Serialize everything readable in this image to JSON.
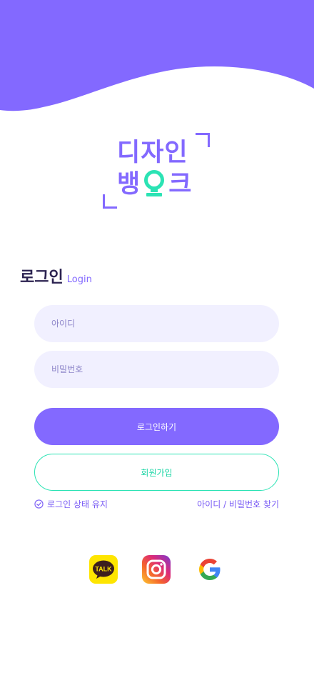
{
  "colors": {
    "accent": "#8369FF",
    "input_bg": "#F1F0FF",
    "join_border": "#2BE3B4",
    "join_text": "#1DD6A6",
    "title_text": "#2B2250"
  },
  "logo": {
    "line1": "디자인",
    "line2_left": "뱅",
    "line2_right": "크",
    "icon": "lightbulb-icon"
  },
  "login": {
    "title": "로그인",
    "title_en": "Login",
    "id_placeholder": "아이디",
    "pw_placeholder": "비밀번호",
    "login_button": "로그인하기",
    "signup_button": "회원가입",
    "keep_login": "로그인 상태 유지",
    "find_account": "아이디 / 비밀번호 찾기"
  },
  "social": {
    "kakao_label": "TALK",
    "items": [
      "kakao-icon",
      "instagram-icon",
      "google-icon"
    ]
  }
}
